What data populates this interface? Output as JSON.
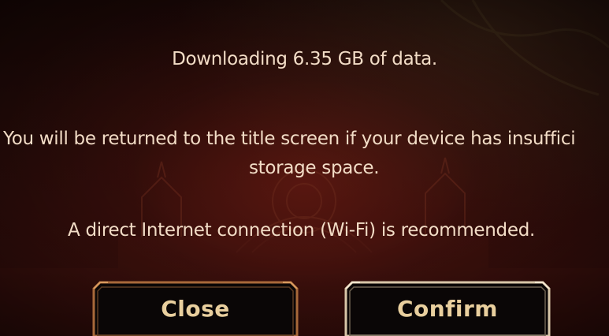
{
  "dialog": {
    "line1": "Downloading 6.35 GB of data.",
    "line2a": "You will be returned to the title screen if your device has insuffici",
    "line2b": "storage space.",
    "line3": "A direct Internet connection (Wi-Fi) is recommended."
  },
  "buttons": {
    "close_label": "Close",
    "confirm_label": "Confirm"
  },
  "colors": {
    "text": "#f2dcc6",
    "button_text": "#e9cf9e",
    "button_fill": "#0a0606",
    "close_frame": "#a8693a",
    "confirm_frame": "#d8c6a8",
    "background": "#2a0c0a"
  }
}
